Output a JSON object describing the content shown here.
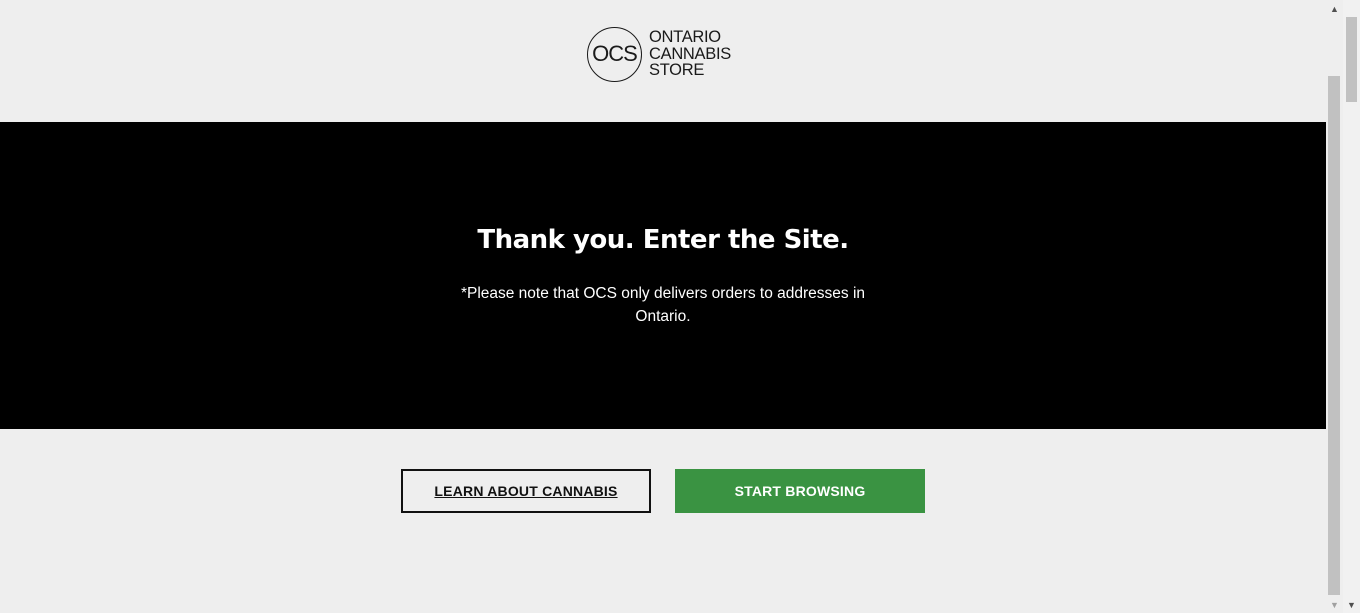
{
  "logo": {
    "monogram": "OCS",
    "line1": "ONTARIO",
    "line2": "CANNABIS",
    "line3": "STORE"
  },
  "banner": {
    "title": "Thank you. Enter the Site.",
    "note": "*Please note that OCS only delivers orders to addresses in Ontario."
  },
  "actions": {
    "learn_label": "LEARN ABOUT CANNABIS",
    "start_label": "START BROWSING"
  },
  "colors": {
    "background": "#eeeeee",
    "banner": "#000000",
    "primary_button": "#3a9342"
  },
  "icons": {
    "scroll_up": "scroll-up-arrow-icon",
    "scroll_down": "scroll-down-arrow-icon"
  }
}
